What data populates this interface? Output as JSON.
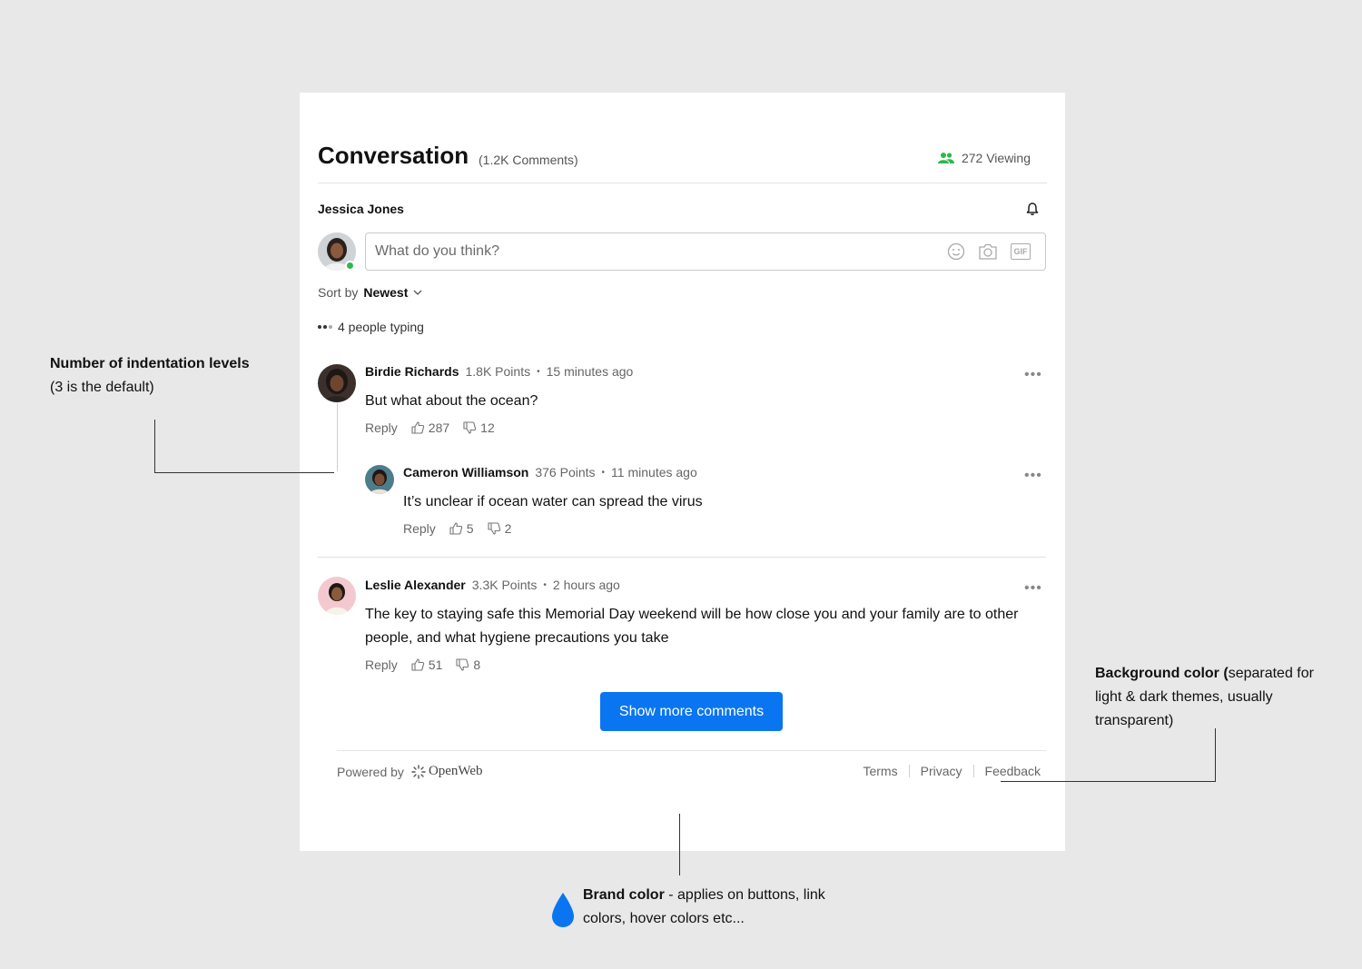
{
  "header": {
    "title": "Conversation",
    "comment_count": "(1.2K Comments)",
    "viewing": "272 Viewing"
  },
  "composer": {
    "user_name": "Jessica Jones",
    "placeholder": "What do you think?",
    "gif_label": "GIF"
  },
  "sort": {
    "label": "Sort by",
    "value": "Newest"
  },
  "typing": "4 people typing",
  "comments": [
    {
      "name": "Birdie Richards",
      "points": "1.8K Points",
      "time": "15 minutes ago",
      "text": "But what about the ocean?",
      "reply": "Reply",
      "likes": "287",
      "dislikes": "12"
    },
    {
      "name": "Cameron Williamson",
      "points": "376 Points",
      "time": "11 minutes ago",
      "text": "It’s unclear if ocean water can spread the virus",
      "reply": "Reply",
      "likes": "5",
      "dislikes": "2"
    },
    {
      "name": "Leslie Alexander",
      "points": "3.3K Points",
      "time": "2 hours ago",
      "text": "The key to staying safe this Memorial Day weekend will be how close you and your family are to other people, and what hygiene precautions you take",
      "reply": "Reply",
      "likes": "51",
      "dislikes": "8"
    }
  ],
  "show_more": "Show more comments",
  "footer": {
    "powered_by": "Powered by",
    "brand": "OpenWeb",
    "links": [
      "Terms",
      "Privacy",
      "Feedback"
    ]
  },
  "annotations": {
    "indentation": {
      "title": "Number of indentation levels",
      "detail": "(3 is the default)"
    },
    "background": {
      "title": "Background color (",
      "detail": "separated for light & dark themes, usually transparent)"
    },
    "brand": {
      "title": "Brand color",
      "detail": " - applies on buttons, link colors, hover colors etc..."
    }
  },
  "colors": {
    "brand": "#0a75f0",
    "online": "#2db84d",
    "viewing_icon": "#2db84d",
    "canvas": "#e8e8e8",
    "card": "#ffffff"
  }
}
